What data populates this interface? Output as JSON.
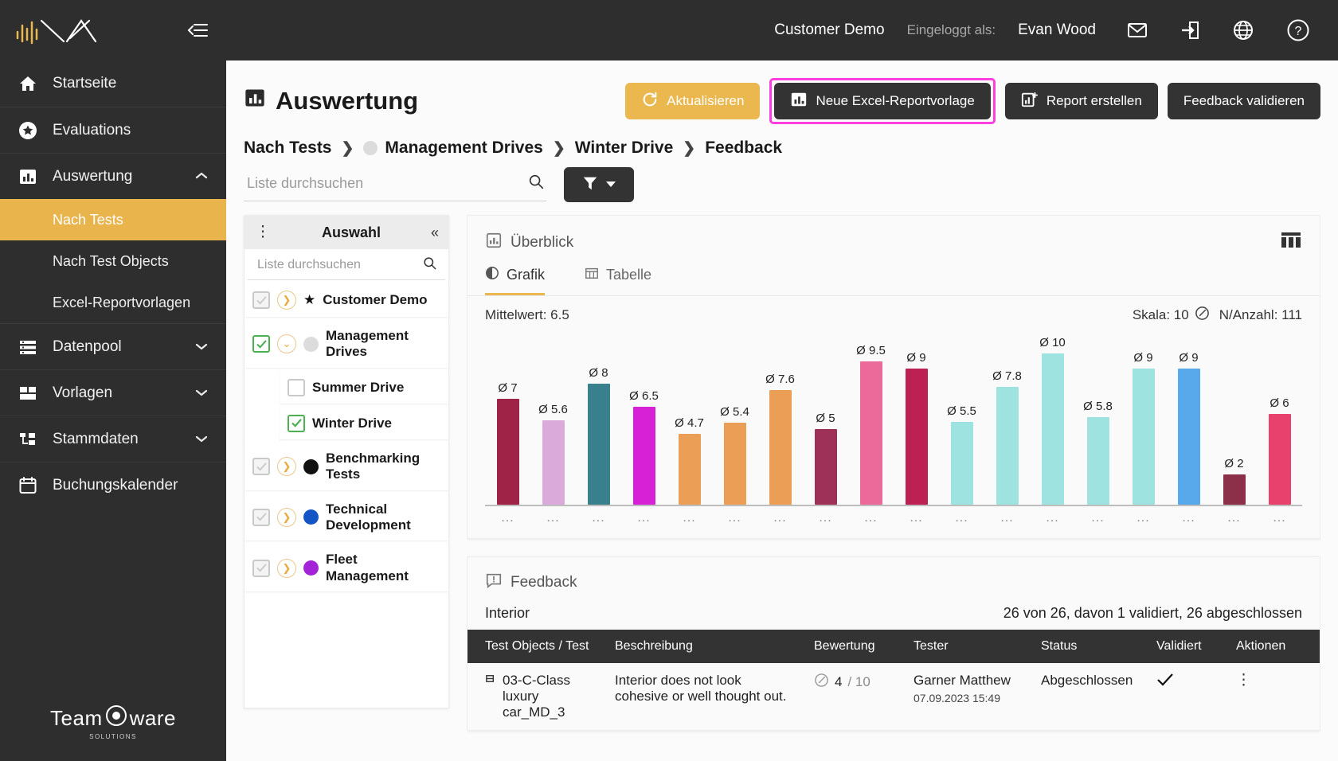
{
  "sidebar": {
    "logo_name": "waveform-logo",
    "collapse_icon": "collapse-sidebar-icon",
    "items": [
      {
        "label": "Startseite",
        "icon": "home-icon",
        "expandable": false
      },
      {
        "label": "Evaluations",
        "icon": "star-circle-icon",
        "expandable": false
      },
      {
        "label": "Auswertung",
        "icon": "bar-chart-icon",
        "expandable": true,
        "expanded": true
      },
      {
        "label": "Datenpool",
        "icon": "list-icon",
        "expandable": true,
        "expanded": false
      },
      {
        "label": "Vorlagen",
        "icon": "layout-icon",
        "expandable": true,
        "expanded": false
      },
      {
        "label": "Stammdaten",
        "icon": "hierarchy-icon",
        "expandable": true,
        "expanded": false
      },
      {
        "label": "Buchungskalender",
        "icon": "calendar-icon",
        "expandable": false
      }
    ],
    "sub_items": [
      {
        "label": "Nach Tests",
        "active": true
      },
      {
        "label": "Nach Test Objects",
        "active": false
      },
      {
        "label": "Excel-Reportvorlagen",
        "active": false
      }
    ],
    "footer": {
      "brand": "Team",
      "brand2": "ware",
      "tagline": "SOLUTIONS"
    }
  },
  "topbar": {
    "tenant": "Customer Demo",
    "logged_in_label": "Eingeloggt als:",
    "user": "Evan Wood",
    "icons": [
      "mail-icon",
      "logout-icon",
      "globe-icon",
      "help-icon"
    ]
  },
  "page": {
    "title": "Auswertung",
    "title_icon": "bar-chart-icon",
    "actions": [
      {
        "label": "Aktualisieren",
        "icon": "refresh-icon",
        "style": "amber",
        "highlighted": false
      },
      {
        "label": "Neue Excel-Reportvorlage",
        "icon": "report-icon",
        "style": "dark",
        "highlighted": true
      },
      {
        "label": "Report erstellen",
        "icon": "report-add-icon",
        "style": "dark",
        "highlighted": false
      },
      {
        "label": "Feedback validieren",
        "icon": "",
        "style": "dark",
        "highlighted": false
      }
    ],
    "highlight_color": "#ff3ee0",
    "breadcrumb": [
      {
        "label": "Nach Tests",
        "dot": ""
      },
      {
        "label": "Management Drives",
        "dot": "#dcdcdc"
      },
      {
        "label": "Winter Drive",
        "dot": ""
      },
      {
        "label": "Feedback",
        "dot": ""
      }
    ],
    "search_placeholder": "Liste durchsuchen",
    "search_value": "",
    "search_icon": "search-icon",
    "filter_icon": "filter-icon"
  },
  "selection": {
    "title": "Auswahl",
    "menu_icon": "kebab-menu-icon",
    "collapse_icon": "double-chevron-left-icon",
    "search_placeholder": "Liste durchsuchen",
    "search_value": "",
    "nodes": [
      {
        "label": "Customer Demo",
        "checkbox": "partial",
        "expand": "collapsed",
        "marker": "star",
        "dot": "",
        "indent": false
      },
      {
        "label": "Management Drives",
        "checkbox": "checked-partial",
        "expand": "expanded",
        "marker": "dot",
        "dot": "#dcdcdc",
        "indent": false
      },
      {
        "label": "Summer Drive",
        "checkbox": "empty",
        "expand": "none",
        "marker": "none",
        "dot": "",
        "indent": true
      },
      {
        "label": "Winter Drive",
        "checkbox": "checked",
        "expand": "none",
        "marker": "none",
        "dot": "",
        "indent": true
      },
      {
        "label": "Benchmarking Tests",
        "checkbox": "partial",
        "expand": "collapsed",
        "marker": "dot",
        "dot": "#111111",
        "indent": false
      },
      {
        "label": "Technical Development",
        "checkbox": "partial",
        "expand": "collapsed",
        "marker": "dot",
        "dot": "#1355c4",
        "indent": false
      },
      {
        "label": "Fleet Management",
        "checkbox": "partial",
        "expand": "collapsed",
        "marker": "dot",
        "dot": "#a324d6",
        "indent": false
      }
    ]
  },
  "overview": {
    "title": "Überblick",
    "title_icon": "bar-chart-icon",
    "grid_icon": "columns-icon",
    "tabs": [
      {
        "label": "Grafik",
        "icon": "pie-chart-icon",
        "active": true
      },
      {
        "label": "Tabelle",
        "icon": "table-icon",
        "active": false
      }
    ],
    "mean_label": "Mittelwert: 6.5",
    "scale_label": "Skala: 10",
    "scale_icon": "gauge-icon",
    "count_label": "N/Anzahl: 111"
  },
  "chart_data": {
    "type": "bar",
    "title": "Überblick",
    "xlabel": "",
    "ylabel": "",
    "ylim": [
      0,
      10
    ],
    "grid": false,
    "legend": false,
    "mean": 6.5,
    "scale": 10,
    "n_count": 111,
    "value_prefix": "Ø ",
    "categories": [
      "...",
      "...",
      "...",
      "...",
      "...",
      "...",
      "...",
      "...",
      "...",
      "...",
      "...",
      "...",
      "...",
      "...",
      "...",
      "...",
      "...",
      "..."
    ],
    "values": [
      7,
      5.6,
      8,
      6.5,
      4.7,
      5.4,
      7.6,
      5,
      9.5,
      9,
      5.5,
      7.8,
      10,
      5.8,
      9,
      9,
      2,
      6
    ],
    "labels": [
      "Ø 7",
      "Ø 5.6",
      "Ø 8",
      "Ø 6.5",
      "Ø 4.7",
      "Ø 5.4",
      "Ø 7.6",
      "Ø 5",
      "Ø 9.5",
      "Ø 9",
      "Ø 5.5",
      "Ø 7.8",
      "Ø 10",
      "Ø 5.8",
      "Ø 9",
      "Ø 9",
      "Ø 2",
      "Ø 6"
    ],
    "colors": [
      "#9e2347",
      "#d9aada",
      "#3a7f8c",
      "#d621d6",
      "#eb9f56",
      "#eb9f56",
      "#eb9f56",
      "#9e3158",
      "#ec6a9a",
      "#bd2053",
      "#9fe3e0",
      "#9fe3e0",
      "#9fe3e0",
      "#9fe3e0",
      "#9fe3e0",
      "#58a8ec",
      "#8b3048",
      "#e8416e"
    ]
  },
  "feedback": {
    "title": "Feedback",
    "title_icon": "comment-alert-icon",
    "section": "Interior",
    "summary": "26 von 26, davon 1 validiert, 26 abgeschlossen",
    "columns": [
      "Test Objects / Test",
      "Beschreibung",
      "Bewertung",
      "Tester",
      "Status",
      "Validiert",
      "Aktionen"
    ],
    "rows": [
      {
        "test_object": "03-C-Class luxury car_MD_3",
        "object_icon": "car-icon",
        "description": "Interior does not look cohesive or well thought out.",
        "rating_icon": "gauge-icon",
        "rating_value": "4",
        "rating_den": "/ 10",
        "tester": "Garner Matthew",
        "timestamp": "07.09.2023 15:49",
        "status": "Abgeschlossen",
        "validated_icon": "check-icon",
        "actions_icon": "kebab-menu-icon"
      }
    ]
  }
}
